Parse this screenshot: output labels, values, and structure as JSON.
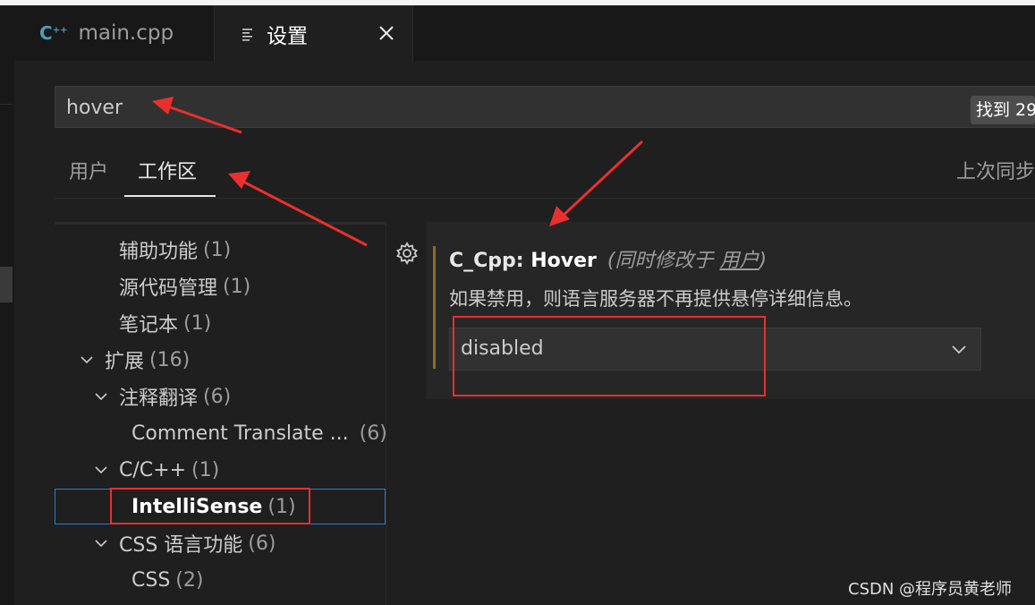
{
  "tabs": {
    "main_cpp": "main.cpp",
    "settings": "设置",
    "cpp_icon_text": "C",
    "cpp_icon_sup": "++"
  },
  "search": {
    "value": "hover",
    "result_count": "找到 29"
  },
  "scope": {
    "user": "用户",
    "workspace": "工作区",
    "last_sync": "上次同步"
  },
  "tree": {
    "items": [
      {
        "label": "辅助功能",
        "count": "(1)"
      },
      {
        "label": "源代码管理",
        "count": "(1)"
      },
      {
        "label": "笔记本",
        "count": "(1)"
      },
      {
        "label": "扩展",
        "count": "(16)"
      },
      {
        "label": "注释翻译",
        "count": "(6)"
      },
      {
        "label": "Comment Translate ...",
        "count": "(6)"
      },
      {
        "label": "C/C++",
        "count": "(1)"
      },
      {
        "label": "IntelliSense",
        "count": "(1)"
      },
      {
        "label": "CSS 语言功能",
        "count": "(6)"
      },
      {
        "label": "CSS",
        "count": "(2)"
      }
    ]
  },
  "setting": {
    "category": "C_Cpp: ",
    "name": "Hover",
    "modified_prefix": "(同时修改于 ",
    "modified_link": "用户",
    "modified_suffix": ")",
    "description": "如果禁用，则语言服务器不再提供悬停详细信息。",
    "value": "disabled"
  },
  "watermark": "CSDN @程序员黄老师",
  "colors": {
    "annotation_red": "#e8302e",
    "modified_bar": "#8a6d28",
    "selection_border": "#2b7bd6"
  }
}
